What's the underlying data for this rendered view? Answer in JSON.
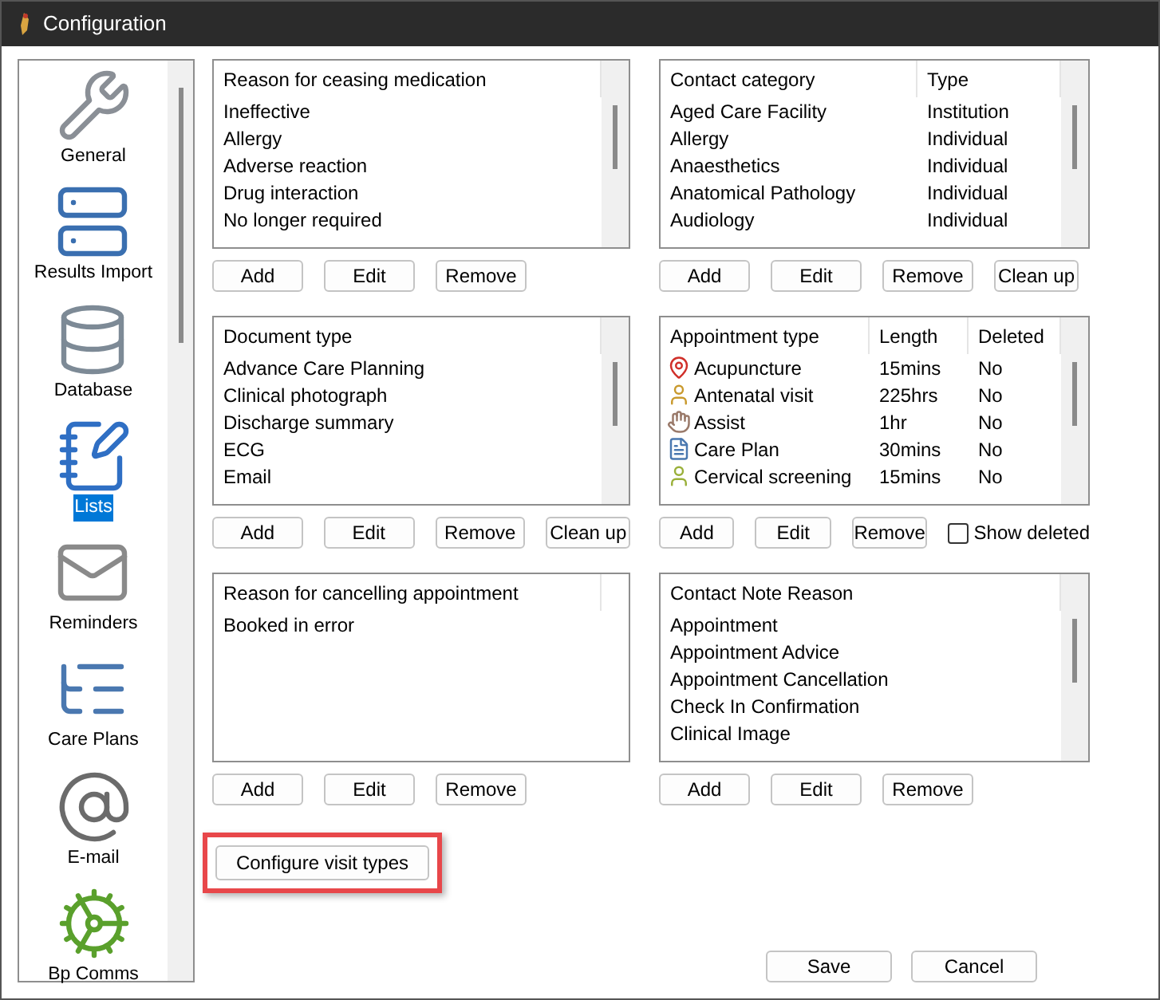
{
  "window": {
    "title": "Configuration"
  },
  "sidebar": {
    "items": [
      {
        "label": "General",
        "selected": false
      },
      {
        "label": "Results Import",
        "selected": false
      },
      {
        "label": "Database",
        "selected": false
      },
      {
        "label": "Lists",
        "selected": true
      },
      {
        "label": "Reminders",
        "selected": false
      },
      {
        "label": "Care Plans",
        "selected": false
      },
      {
        "label": "E-mail",
        "selected": false
      },
      {
        "label": "Bp Comms",
        "selected": false
      }
    ]
  },
  "lists": [
    {
      "kind": "plain",
      "columns": [
        "Reason for ceasing medication"
      ],
      "rows": [
        [
          "Ineffective"
        ],
        [
          "Allergy"
        ],
        [
          "Adverse reaction"
        ],
        [
          "Drug interaction"
        ],
        [
          "No longer required"
        ]
      ],
      "buttons": [
        "Add",
        "Edit",
        "Remove"
      ]
    },
    {
      "kind": "plain",
      "columns": [
        "Contact category",
        "Type"
      ],
      "rows": [
        [
          "Aged Care Facility",
          "Institution"
        ],
        [
          "Allergy",
          "Individual"
        ],
        [
          "Anaesthetics",
          "Individual"
        ],
        [
          "Anatomical Pathology",
          "Individual"
        ],
        [
          "Audiology",
          "Individual"
        ]
      ],
      "buttons": [
        "Add",
        "Edit",
        "Remove",
        "Clean up"
      ]
    },
    {
      "kind": "plain",
      "columns": [
        "Document type"
      ],
      "rows": [
        [
          "Advance Care Planning"
        ],
        [
          "Clinical photograph"
        ],
        [
          "Discharge summary"
        ],
        [
          "ECG"
        ],
        [
          "Email"
        ]
      ],
      "buttons": [
        "Add",
        "Edit",
        "Remove",
        "Clean up"
      ]
    },
    {
      "kind": "icon-rows",
      "columns": [
        "Appointment type",
        "Length",
        "Deleted"
      ],
      "rows": [
        [
          "Acupuncture",
          "15mins",
          "No"
        ],
        [
          "Antenatal visit",
          "225hrs",
          "No"
        ],
        [
          "Assist",
          "1hr",
          "No"
        ],
        [
          "Care Plan",
          "30mins",
          "No"
        ],
        [
          "Cervical screening",
          "15mins",
          "No"
        ]
      ],
      "buttons": [
        "Add",
        "Edit",
        "Remove"
      ],
      "checkbox": {
        "label": "Show deleted",
        "checked": false
      }
    },
    {
      "kind": "plain",
      "columns": [
        "Reason for cancelling appointment"
      ],
      "rows": [
        [
          "Booked in error"
        ]
      ],
      "buttons": [
        "Add",
        "Edit",
        "Remove"
      ]
    },
    {
      "kind": "plain",
      "columns": [
        "Contact Note Reason"
      ],
      "rows": [
        [
          "Appointment"
        ],
        [
          "Appointment Advice"
        ],
        [
          "Appointment Cancellation"
        ],
        [
          "Check In Confirmation"
        ],
        [
          "Clinical Image"
        ]
      ],
      "buttons": [
        "Add",
        "Edit",
        "Remove"
      ]
    }
  ],
  "configure_button": {
    "label": "Configure visit types",
    "highlighted": true
  },
  "footer_buttons": [
    "Save",
    "Cancel"
  ]
}
